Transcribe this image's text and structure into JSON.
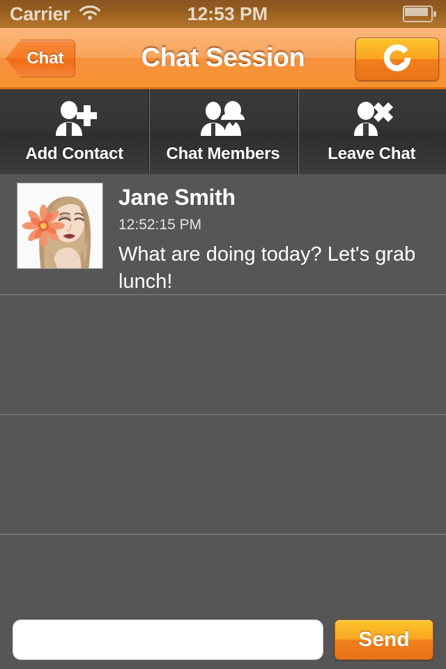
{
  "status_bar": {
    "carrier": "Carrier",
    "wifi_icon": "wifi-icon",
    "time": "12:53 PM",
    "battery_icon": "battery-icon"
  },
  "nav_bar": {
    "back_label": "Chat",
    "title": "Chat Session",
    "refresh_icon": "refresh-icon"
  },
  "toolbar": {
    "items": [
      {
        "label": "Add Contact",
        "icon": "person-add-icon"
      },
      {
        "label": "Chat Members",
        "icon": "people-group-icon"
      },
      {
        "label": "Leave Chat",
        "icon": "person-remove-icon"
      }
    ]
  },
  "chat": {
    "messages": [
      {
        "sender": "Jane Smith",
        "time": "12:52:15 PM",
        "text": "What are doing today? Let's grab lunch!",
        "avatar": "woman-with-orange-flower-portrait"
      }
    ],
    "empty_row_count": 3
  },
  "input_bar": {
    "placeholder": "",
    "value": "",
    "send_label": "Send"
  },
  "colors": {
    "accent_orange": "#f6922f",
    "nav_gradient_top": "#fab77a",
    "button_gradient_top": "#fcc52c",
    "button_gradient_bottom": "#e8731a",
    "status_bar_brown": "#97601f",
    "toolbar_dark": "#343434",
    "table_background": "#565656",
    "separator": "#6f7378"
  }
}
